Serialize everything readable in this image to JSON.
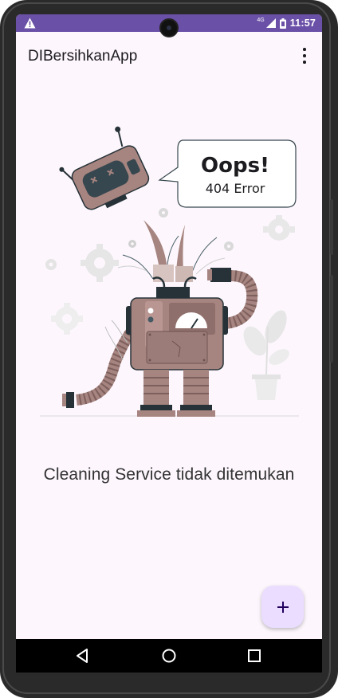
{
  "status_bar": {
    "network": "4G",
    "time": "11:57",
    "warning_icon": "warning-icon",
    "signal_icon": "signal-icon",
    "battery_icon": "battery-icon"
  },
  "app_bar": {
    "title": "DIBersihkanApp",
    "menu_icon": "more-vert-icon"
  },
  "illustration": {
    "bubble_title": "Oops!",
    "bubble_subtitle": "404 Error"
  },
  "message": "Cleaning Service tidak ditemukan",
  "fab": {
    "icon": "add-icon",
    "label": "+"
  },
  "nav_bar": {
    "back_icon": "back-icon",
    "home_icon": "home-icon",
    "recents_icon": "recents-icon"
  },
  "colors": {
    "status_bar": "#6a50a7",
    "background": "#fdf7fd",
    "fab": "#eaddff",
    "robot_body": "#a68480",
    "robot_dark": "#263238"
  }
}
